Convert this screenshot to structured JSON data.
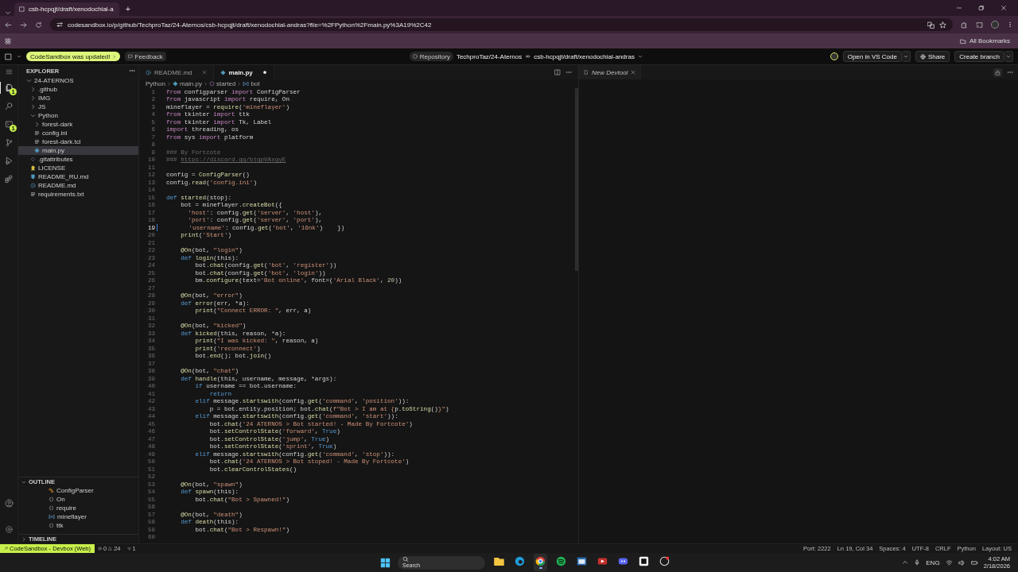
{
  "browser": {
    "tab_title": "csb-hcpqjt/draft/xenodochial-a",
    "new_tab": "+",
    "url": "codesandbox.io/p/github/TechproTaz/24-Aternos/csb-hcpqjt/draft/xenodochial-andras?file=%2FPython%2Fmain.py%3A19%2C42",
    "bookmarks_label": "All Bookmarks"
  },
  "header": {
    "update_badge": "CodeSandbox was updated!",
    "feedback": "Feedback",
    "repository": "Repository",
    "repo_name": "TechproTaz/24-Aternos",
    "branch": "csb-hcpqjt/draft/xenodochial-andras",
    "open_button": "Open in VS Code",
    "share_button": "Share",
    "branch_button": "Create branch"
  },
  "activity_bar": [
    {
      "kind": "files",
      "badge": "1",
      "selected": true
    },
    {
      "kind": "search",
      "selected": false
    },
    {
      "kind": "terminal",
      "badge": "1",
      "selected": false
    },
    {
      "kind": "branch",
      "selected": false
    },
    {
      "kind": "run",
      "selected": false
    },
    {
      "kind": "extensions",
      "selected": false
    }
  ],
  "explorer": {
    "title": "EXPLORER",
    "root": {
      "label": "24-ATERNOS",
      "kind": "folder",
      "expanded": true,
      "selected": false,
      "children": [
        {
          "label": ".github",
          "kind": "folder",
          "expanded": false,
          "selected": false
        },
        {
          "label": "IMG",
          "kind": "folder",
          "expanded": false,
          "selected": false
        },
        {
          "label": "JS",
          "kind": "folder",
          "expanded": false,
          "selected": false
        },
        {
          "label": "Python",
          "kind": "folder",
          "expanded": true,
          "selected": false,
          "children": [
            {
              "label": "forest-dark",
              "kind": "folder",
              "expanded": false,
              "selected": false
            },
            {
              "label": "config.ini",
              "kind": "text",
              "selected": false
            },
            {
              "label": "forest-dark.tcl",
              "kind": "text",
              "selected": false
            },
            {
              "label": "main.py",
              "kind": "python",
              "selected": true
            }
          ]
        },
        {
          "label": ".gitattributes",
          "kind": "git",
          "selected": false
        },
        {
          "label": "LICENSE",
          "kind": "license",
          "selected": false
        },
        {
          "label": "README_RU.md",
          "kind": "download",
          "selected": false
        },
        {
          "label": "README.md",
          "kind": "info",
          "selected": false
        },
        {
          "label": "requirements.txt",
          "kind": "text",
          "selected": false
        }
      ]
    }
  },
  "outline": {
    "title": "OUTLINE",
    "items": [
      {
        "label": "ConfigParser",
        "kind": "class"
      },
      {
        "label": "On",
        "kind": "module"
      },
      {
        "label": "require",
        "kind": "module"
      },
      {
        "label": "mineflayer",
        "kind": "variable"
      },
      {
        "label": "ttk",
        "kind": "module"
      }
    ]
  },
  "timeline": {
    "title": "TIMELINE"
  },
  "editor": {
    "tabs": [
      {
        "label": "README.md",
        "kind": "info",
        "selected": false,
        "modified": false
      },
      {
        "label": "main.py",
        "kind": "python",
        "selected": true,
        "modified": true
      }
    ],
    "breadcrumbs": [
      {
        "label": "Python",
        "kind": "folder"
      },
      {
        "label": "main.py",
        "kind": "python"
      },
      {
        "label": "started",
        "kind": "function"
      },
      {
        "label": "bot",
        "kind": "variable"
      }
    ],
    "lines": [
      {
        "n": "1",
        "current": false,
        "t": [
          {
            "kind": "m",
            "text": "from"
          },
          {
            "kind": "p",
            "text": " configparser "
          },
          {
            "kind": "m",
            "text": "import"
          },
          {
            "kind": "p",
            "text": " ConfigParser"
          }
        ]
      },
      {
        "n": "2",
        "current": false,
        "t": [
          {
            "kind": "m",
            "text": "from"
          },
          {
            "kind": "p",
            "text": " javascript "
          },
          {
            "kind": "m",
            "text": "import"
          },
          {
            "kind": "p",
            "text": " require, On"
          }
        ]
      },
      {
        "n": "3",
        "current": false,
        "t": [
          {
            "kind": "p",
            "text": "mineflayer = "
          },
          {
            "kind": "f",
            "text": "require"
          },
          {
            "kind": "p",
            "text": "("
          },
          {
            "kind": "s",
            "text": "'mineflayer'"
          },
          {
            "kind": "p",
            "text": ")"
          }
        ]
      },
      {
        "n": "4",
        "current": false,
        "t": [
          {
            "kind": "m",
            "text": "from"
          },
          {
            "kind": "p",
            "text": " tkinter "
          },
          {
            "kind": "m",
            "text": "import"
          },
          {
            "kind": "p",
            "text": " ttk"
          }
        ]
      },
      {
        "n": "5",
        "current": false,
        "t": [
          {
            "kind": "m",
            "text": "from"
          },
          {
            "kind": "p",
            "text": " tkinter "
          },
          {
            "kind": "m",
            "text": "import"
          },
          {
            "kind": "p",
            "text": " Tk, Label"
          }
        ]
      },
      {
        "n": "6",
        "current": false,
        "t": [
          {
            "kind": "m",
            "text": "import"
          },
          {
            "kind": "p",
            "text": " threading, os"
          }
        ]
      },
      {
        "n": "7",
        "current": false,
        "t": [
          {
            "kind": "m",
            "text": "from"
          },
          {
            "kind": "p",
            "text": " sys "
          },
          {
            "kind": "m",
            "text": "import"
          },
          {
            "kind": "p",
            "text": " platform"
          }
        ]
      },
      {
        "n": "8",
        "current": false
      },
      {
        "n": "9",
        "current": false,
        "t": [
          {
            "kind": "c",
            "text": "### By Fortcote"
          }
        ]
      },
      {
        "n": "10",
        "current": false,
        "t": [
          {
            "kind": "c",
            "text": "### "
          },
          {
            "kind": "u",
            "text": "https://discord.gg/bjgpVAxgyE"
          }
        ]
      },
      {
        "n": "11",
        "current": false
      },
      {
        "n": "12",
        "current": false,
        "t": [
          {
            "kind": "p",
            "text": "config = "
          },
          {
            "kind": "f",
            "text": "ConfigParser"
          },
          {
            "kind": "p",
            "text": "()"
          }
        ]
      },
      {
        "n": "13",
        "current": false,
        "t": [
          {
            "kind": "p",
            "text": "config."
          },
          {
            "kind": "f",
            "text": "read"
          },
          {
            "kind": "p",
            "text": "("
          },
          {
            "kind": "s",
            "text": "'config.ini'"
          },
          {
            "kind": "p",
            "text": ")"
          }
        ]
      },
      {
        "n": "14",
        "current": false
      },
      {
        "n": "15",
        "current": false,
        "t": [
          {
            "kind": "k",
            "text": "def "
          },
          {
            "kind": "f",
            "text": "started"
          },
          {
            "kind": "p",
            "text": "(stop):"
          }
        ]
      },
      {
        "n": "16",
        "current": false,
        "t": [
          {
            "kind": "p",
            "text": "    bot = mineflayer."
          },
          {
            "kind": "f",
            "text": "createBot"
          },
          {
            "kind": "p",
            "text": "({"
          }
        ]
      },
      {
        "n": "17",
        "current": false,
        "t": [
          {
            "kind": "s",
            "text": "      'host'"
          },
          {
            "kind": "p",
            "text": ": config."
          },
          {
            "kind": "f",
            "text": "get"
          },
          {
            "kind": "p",
            "text": "("
          },
          {
            "kind": "s",
            "text": "'server'"
          },
          {
            "kind": "p",
            "text": ", "
          },
          {
            "kind": "s",
            "text": "'host'"
          },
          {
            "kind": "p",
            "text": "),"
          }
        ]
      },
      {
        "n": "18",
        "current": false,
        "t": [
          {
            "kind": "s",
            "text": "      'port'"
          },
          {
            "kind": "p",
            "text": ": config."
          },
          {
            "kind": "f",
            "text": "get"
          },
          {
            "kind": "p",
            "text": "("
          },
          {
            "kind": "s",
            "text": "'server'"
          },
          {
            "kind": "p",
            "text": ", "
          },
          {
            "kind": "s",
            "text": "'port'"
          },
          {
            "kind": "p",
            "text": "),"
          }
        ]
      },
      {
        "n": "19",
        "current": true,
        "t": [
          {
            "kind": "s",
            "text": "      'username'"
          },
          {
            "kind": "p",
            "text": ": config."
          },
          {
            "kind": "f",
            "text": "get"
          },
          {
            "kind": "p",
            "text": "("
          },
          {
            "kind": "s",
            "text": "'bot'"
          },
          {
            "kind": "p",
            "text": ", "
          },
          {
            "kind": "s",
            "text": "'16nk'"
          },
          {
            "kind": "p",
            "text": ")    })"
          }
        ]
      },
      {
        "n": "20",
        "current": false,
        "t": [
          {
            "kind": "f",
            "text": "    print"
          },
          {
            "kind": "p",
            "text": "("
          },
          {
            "kind": "s",
            "text": "'Start'"
          },
          {
            "kind": "p",
            "text": ")"
          }
        ]
      },
      {
        "n": "21",
        "current": false
      },
      {
        "n": "22",
        "current": false,
        "t": [
          {
            "kind": "f",
            "text": "    @On"
          },
          {
            "kind": "p",
            "text": "(bot, "
          },
          {
            "kind": "s",
            "text": "\"login\""
          },
          {
            "kind": "p",
            "text": ")"
          }
        ]
      },
      {
        "n": "23",
        "current": false,
        "t": [
          {
            "kind": "k",
            "text": "    def "
          },
          {
            "kind": "f",
            "text": "login"
          },
          {
            "kind": "p",
            "text": "(this):"
          }
        ]
      },
      {
        "n": "24",
        "current": false,
        "t": [
          {
            "kind": "p",
            "text": "        bot."
          },
          {
            "kind": "f",
            "text": "chat"
          },
          {
            "kind": "p",
            "text": "(config."
          },
          {
            "kind": "f",
            "text": "get"
          },
          {
            "kind": "p",
            "text": "("
          },
          {
            "kind": "s",
            "text": "'bot'"
          },
          {
            "kind": "p",
            "text": ", "
          },
          {
            "kind": "s",
            "text": "'register'"
          },
          {
            "kind": "p",
            "text": "))"
          }
        ]
      },
      {
        "n": "25",
        "current": false,
        "t": [
          {
            "kind": "p",
            "text": "        bot."
          },
          {
            "kind": "f",
            "text": "chat"
          },
          {
            "kind": "p",
            "text": "(config."
          },
          {
            "kind": "f",
            "text": "get"
          },
          {
            "kind": "p",
            "text": "("
          },
          {
            "kind": "s",
            "text": "'bot'"
          },
          {
            "kind": "p",
            "text": ", "
          },
          {
            "kind": "s",
            "text": "'login'"
          },
          {
            "kind": "p",
            "text": "))"
          }
        ]
      },
      {
        "n": "26",
        "current": false,
        "t": [
          {
            "kind": "p",
            "text": "        bm."
          },
          {
            "kind": "f",
            "text": "configure"
          },
          {
            "kind": "p",
            "text": "(text="
          },
          {
            "kind": "s",
            "text": "'Bot online'"
          },
          {
            "kind": "p",
            "text": ", font=("
          },
          {
            "kind": "s",
            "text": "'Arial Black'"
          },
          {
            "kind": "p",
            "text": ", "
          },
          {
            "kind": "n",
            "text": "20"
          },
          {
            "kind": "p",
            "text": "))"
          }
        ]
      },
      {
        "n": "27",
        "current": false
      },
      {
        "n": "28",
        "current": false,
        "t": [
          {
            "kind": "f",
            "text": "    @On"
          },
          {
            "kind": "p",
            "text": "(bot, "
          },
          {
            "kind": "s",
            "text": "\"error\""
          },
          {
            "kind": "p",
            "text": ")"
          }
        ]
      },
      {
        "n": "29",
        "current": false,
        "t": [
          {
            "kind": "k",
            "text": "    def "
          },
          {
            "kind": "f",
            "text": "error"
          },
          {
            "kind": "p",
            "text": "(err, *a):"
          }
        ]
      },
      {
        "n": "30",
        "current": false,
        "t": [
          {
            "kind": "f",
            "text": "        print"
          },
          {
            "kind": "p",
            "text": "("
          },
          {
            "kind": "s",
            "text": "\"Connect ERROR: \""
          },
          {
            "kind": "p",
            "text": ", err, a)"
          }
        ]
      },
      {
        "n": "31",
        "current": false
      },
      {
        "n": "32",
        "current": false,
        "t": [
          {
            "kind": "f",
            "text": "    @On"
          },
          {
            "kind": "p",
            "text": "(bot, "
          },
          {
            "kind": "s",
            "text": "\"kicked\""
          },
          {
            "kind": "p",
            "text": ")"
          }
        ]
      },
      {
        "n": "33",
        "current": false,
        "t": [
          {
            "kind": "k",
            "text": "    def "
          },
          {
            "kind": "f",
            "text": "kicked"
          },
          {
            "kind": "p",
            "text": "(this, reason, *a):"
          }
        ]
      },
      {
        "n": "34",
        "current": false,
        "t": [
          {
            "kind": "f",
            "text": "        print"
          },
          {
            "kind": "p",
            "text": "("
          },
          {
            "kind": "s",
            "text": "\"I was kicked: \""
          },
          {
            "kind": "p",
            "text": ", reason, a)"
          }
        ]
      },
      {
        "n": "35",
        "current": false,
        "t": [
          {
            "kind": "f",
            "text": "        print"
          },
          {
            "kind": "p",
            "text": "("
          },
          {
            "kind": "s",
            "text": "'reconnect'"
          },
          {
            "kind": "p",
            "text": ")"
          }
        ]
      },
      {
        "n": "36",
        "current": false,
        "t": [
          {
            "kind": "p",
            "text": "        bot."
          },
          {
            "kind": "f",
            "text": "end"
          },
          {
            "kind": "p",
            "text": "(); bot."
          },
          {
            "kind": "f",
            "text": "join"
          },
          {
            "kind": "p",
            "text": "()"
          }
        ]
      },
      {
        "n": "37",
        "current": false
      },
      {
        "n": "38",
        "current": false,
        "t": [
          {
            "kind": "f",
            "text": "    @On"
          },
          {
            "kind": "p",
            "text": "(bot, "
          },
          {
            "kind": "s",
            "text": "\"chat\""
          },
          {
            "kind": "p",
            "text": ")"
          }
        ]
      },
      {
        "n": "39",
        "current": false,
        "t": [
          {
            "kind": "k",
            "text": "    def "
          },
          {
            "kind": "f",
            "text": "handle"
          },
          {
            "kind": "p",
            "text": "(this, username, message, *args):"
          }
        ]
      },
      {
        "n": "40",
        "current": false,
        "t": [
          {
            "kind": "k",
            "text": "        if"
          },
          {
            "kind": "p",
            "text": " username == bot.username:"
          }
        ]
      },
      {
        "n": "41",
        "current": false,
        "t": [
          {
            "kind": "k",
            "text": "            return"
          }
        ]
      },
      {
        "n": "42",
        "current": false,
        "t": [
          {
            "kind": "k",
            "text": "        elif"
          },
          {
            "kind": "p",
            "text": " message."
          },
          {
            "kind": "f",
            "text": "startswith"
          },
          {
            "kind": "p",
            "text": "(config."
          },
          {
            "kind": "f",
            "text": "get"
          },
          {
            "kind": "p",
            "text": "("
          },
          {
            "kind": "s",
            "text": "'command'"
          },
          {
            "kind": "p",
            "text": ", "
          },
          {
            "kind": "s",
            "text": "'position'"
          },
          {
            "kind": "p",
            "text": ")):"
          }
        ]
      },
      {
        "n": "43",
        "current": false,
        "t": [
          {
            "kind": "p",
            "text": "            p = bot.entity.position; bot."
          },
          {
            "kind": "f",
            "text": "chat"
          },
          {
            "kind": "p",
            "text": "("
          },
          {
            "kind": "s",
            "text": "f\"Bot > I am at {"
          },
          {
            "kind": "p",
            "text": "p."
          },
          {
            "kind": "f",
            "text": "toString"
          },
          {
            "kind": "p",
            "text": "()"
          },
          {
            "kind": "s",
            "text": "}\""
          },
          {
            "kind": "p",
            "text": ")"
          }
        ]
      },
      {
        "n": "44",
        "current": false,
        "t": [
          {
            "kind": "k",
            "text": "        elif"
          },
          {
            "kind": "p",
            "text": " message."
          },
          {
            "kind": "f",
            "text": "startswith"
          },
          {
            "kind": "p",
            "text": "(config."
          },
          {
            "kind": "f",
            "text": "get"
          },
          {
            "kind": "p",
            "text": "("
          },
          {
            "kind": "s",
            "text": "'command'"
          },
          {
            "kind": "p",
            "text": ", "
          },
          {
            "kind": "s",
            "text": "'start'"
          },
          {
            "kind": "p",
            "text": ")):"
          }
        ]
      },
      {
        "n": "45",
        "current": false,
        "t": [
          {
            "kind": "p",
            "text": "            bot."
          },
          {
            "kind": "f",
            "text": "chat"
          },
          {
            "kind": "p",
            "text": "("
          },
          {
            "kind": "s",
            "text": "'24 ATERNOS > Bot started! - Made By Fortcote'"
          },
          {
            "kind": "p",
            "text": ")"
          }
        ]
      },
      {
        "n": "46",
        "current": false,
        "t": [
          {
            "kind": "p",
            "text": "            bot."
          },
          {
            "kind": "f",
            "text": "setControlState"
          },
          {
            "kind": "p",
            "text": "("
          },
          {
            "kind": "s",
            "text": "'forward'"
          },
          {
            "kind": "p",
            "text": ", "
          },
          {
            "kind": "k",
            "text": "True"
          },
          {
            "kind": "p",
            "text": ")"
          }
        ]
      },
      {
        "n": "47",
        "current": false,
        "t": [
          {
            "kind": "p",
            "text": "            bot."
          },
          {
            "kind": "f",
            "text": "setControlState"
          },
          {
            "kind": "p",
            "text": "("
          },
          {
            "kind": "s",
            "text": "'jump'"
          },
          {
            "kind": "p",
            "text": ", "
          },
          {
            "kind": "k",
            "text": "True"
          },
          {
            "kind": "p",
            "text": ")"
          }
        ]
      },
      {
        "n": "48",
        "current": false,
        "t": [
          {
            "kind": "p",
            "text": "            bot."
          },
          {
            "kind": "f",
            "text": "setControlState"
          },
          {
            "kind": "p",
            "text": "("
          },
          {
            "kind": "s",
            "text": "'sprint'"
          },
          {
            "kind": "p",
            "text": ", "
          },
          {
            "kind": "k",
            "text": "True"
          },
          {
            "kind": "p",
            "text": ")"
          }
        ]
      },
      {
        "n": "49",
        "current": false,
        "t": [
          {
            "kind": "k",
            "text": "        elif"
          },
          {
            "kind": "p",
            "text": " message."
          },
          {
            "kind": "f",
            "text": "startswith"
          },
          {
            "kind": "p",
            "text": "(config."
          },
          {
            "kind": "f",
            "text": "get"
          },
          {
            "kind": "p",
            "text": "("
          },
          {
            "kind": "s",
            "text": "'command'"
          },
          {
            "kind": "p",
            "text": ", "
          },
          {
            "kind": "s",
            "text": "'stop'"
          },
          {
            "kind": "p",
            "text": ")):"
          }
        ]
      },
      {
        "n": "50",
        "current": false,
        "t": [
          {
            "kind": "p",
            "text": "            bot."
          },
          {
            "kind": "f",
            "text": "chat"
          },
          {
            "kind": "p",
            "text": "("
          },
          {
            "kind": "s",
            "text": "'24 ATERNOS > Bot stoped! - Made By Fortcote'"
          },
          {
            "kind": "p",
            "text": ")"
          }
        ]
      },
      {
        "n": "51",
        "current": false,
        "t": [
          {
            "kind": "p",
            "text": "            bot."
          },
          {
            "kind": "f",
            "text": "clearControlStates"
          },
          {
            "kind": "p",
            "text": "()"
          }
        ]
      },
      {
        "n": "52",
        "current": false
      },
      {
        "n": "53",
        "current": false,
        "t": [
          {
            "kind": "f",
            "text": "    @On"
          },
          {
            "kind": "p",
            "text": "(bot, "
          },
          {
            "kind": "s",
            "text": "\"spawn\""
          },
          {
            "kind": "p",
            "text": ")"
          }
        ]
      },
      {
        "n": "54",
        "current": false,
        "t": [
          {
            "kind": "k",
            "text": "    def "
          },
          {
            "kind": "f",
            "text": "spawn"
          },
          {
            "kind": "p",
            "text": "(this):"
          }
        ]
      },
      {
        "n": "55",
        "current": false,
        "t": [
          {
            "kind": "p",
            "text": "        bot."
          },
          {
            "kind": "f",
            "text": "chat"
          },
          {
            "kind": "p",
            "text": "("
          },
          {
            "kind": "s",
            "text": "\"Bot > Spawned!\""
          },
          {
            "kind": "p",
            "text": ")"
          }
        ]
      },
      {
        "n": "56",
        "current": false
      },
      {
        "n": "57",
        "current": false,
        "t": [
          {
            "kind": "f",
            "text": "    @On"
          },
          {
            "kind": "p",
            "text": "(bot, "
          },
          {
            "kind": "s",
            "text": "\"death\""
          },
          {
            "kind": "p",
            "text": ")"
          }
        ]
      },
      {
        "n": "58",
        "current": false,
        "t": [
          {
            "kind": "k",
            "text": "    def "
          },
          {
            "kind": "f",
            "text": "death"
          },
          {
            "kind": "p",
            "text": "(this):"
          }
        ]
      },
      {
        "n": "59",
        "current": false,
        "t": [
          {
            "kind": "p",
            "text": "        bot."
          },
          {
            "kind": "f",
            "text": "chat"
          },
          {
            "kind": "p",
            "text": "("
          },
          {
            "kind": "s",
            "text": "\"Bot > Respawn!\""
          },
          {
            "kind": "p",
            "text": ")"
          }
        ]
      },
      {
        "n": "60",
        "current": false
      }
    ]
  },
  "devtools": {
    "tabs": [
      {
        "label": "New Devtool",
        "selected": true
      }
    ]
  },
  "status_bar": {
    "remote": "CodeSandbox - Devbox (Web)",
    "errors": "0",
    "warnings": "24",
    "ports": "1",
    "right": [
      "Port: 2222",
      "Ln 19, Col 34",
      "Spaces: 4",
      "UTF-8",
      "CRLF",
      "Python",
      "Layout: US"
    ]
  },
  "taskbar": {
    "search": "Search",
    "apps": [
      {
        "kind": "folder",
        "selected": false
      },
      {
        "kind": "edge",
        "selected": false
      },
      {
        "kind": "chrome",
        "selected": true
      },
      {
        "kind": "music",
        "selected": false
      },
      {
        "kind": "notes",
        "selected": false
      },
      {
        "kind": "video",
        "selected": false
      },
      {
        "kind": "chat",
        "selected": false
      },
      {
        "kind": "terminal",
        "selected": false
      },
      {
        "kind": "game",
        "selected": false
      }
    ],
    "language": "ENG",
    "time": "4:02 AM",
    "date": "2/18/2026"
  }
}
